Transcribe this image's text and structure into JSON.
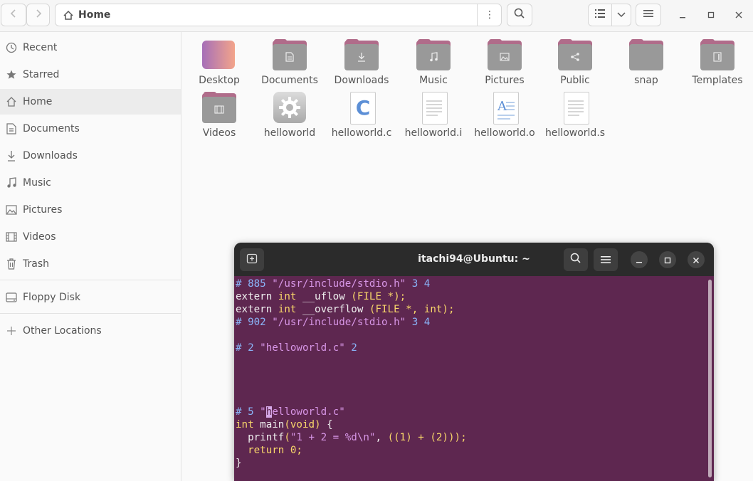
{
  "header": {
    "path_label": "Home",
    "icons": [
      "back-icon",
      "forward-icon",
      "home-icon",
      "more-options-icon",
      "search-icon",
      "list-view-icon",
      "chevron-down-icon",
      "hamburger-menu-icon",
      "minimize-icon",
      "maximize-icon",
      "close-icon"
    ]
  },
  "sidebar": {
    "items": [
      {
        "label": "Recent",
        "icon": "clock-icon"
      },
      {
        "label": "Starred",
        "icon": "star-icon"
      },
      {
        "label": "Home",
        "icon": "home-icon"
      },
      {
        "label": "Documents",
        "icon": "document-icon"
      },
      {
        "label": "Downloads",
        "icon": "download-icon"
      },
      {
        "label": "Music",
        "icon": "music-icon"
      },
      {
        "label": "Pictures",
        "icon": "picture-icon"
      },
      {
        "label": "Videos",
        "icon": "video-icon"
      },
      {
        "label": "Trash",
        "icon": "trash-icon"
      },
      {
        "label": "Floppy Disk",
        "icon": "drive-icon"
      },
      {
        "label": "Other Locations",
        "icon": "plus-icon"
      }
    ],
    "active": "Home"
  },
  "files": [
    {
      "name": "Desktop",
      "type": "desktop-folder"
    },
    {
      "name": "Documents",
      "type": "folder",
      "emblem": "document"
    },
    {
      "name": "Downloads",
      "type": "folder",
      "emblem": "download"
    },
    {
      "name": "Music",
      "type": "folder",
      "emblem": "music"
    },
    {
      "name": "Pictures",
      "type": "folder",
      "emblem": "picture"
    },
    {
      "name": "Public",
      "type": "folder",
      "emblem": "share"
    },
    {
      "name": "snap",
      "type": "folder",
      "emblem": ""
    },
    {
      "name": "Templates",
      "type": "folder",
      "emblem": "template"
    },
    {
      "name": "Videos",
      "type": "folder",
      "emblem": "video"
    },
    {
      "name": "helloworld",
      "type": "executable"
    },
    {
      "name": "helloworld.c",
      "type": "c-source"
    },
    {
      "name": "helloworld.i",
      "type": "text"
    },
    {
      "name": "helloworld.o",
      "type": "object"
    },
    {
      "name": "helloworld.s",
      "type": "text"
    }
  ],
  "terminal": {
    "title": "itachi94@Ubuntu: ~",
    "colors": {
      "background": "#5e2750",
      "directive": "#8ab4f8",
      "string": "#d796e6",
      "keyword": "#f9d76a",
      "text": "#f0f0f0"
    },
    "lines": [
      [
        [
          "# 885 ",
          "c-blue"
        ],
        [
          "\"/usr/include/stdio.h\"",
          "c-mag"
        ],
        [
          " 3 4",
          "c-blue"
        ]
      ],
      [
        [
          "extern ",
          "c-white"
        ],
        [
          "int",
          "c-yel"
        ],
        [
          " __uflow ",
          "c-white"
        ],
        [
          "(FILE *);",
          "c-yel"
        ]
      ],
      [
        [
          "extern ",
          "c-white"
        ],
        [
          "int",
          "c-yel"
        ],
        [
          " __overflow ",
          "c-white"
        ],
        [
          "(FILE *, int);",
          "c-yel"
        ]
      ],
      [
        [
          "# 902 ",
          "c-blue"
        ],
        [
          "\"/usr/include/stdio.h\"",
          "c-mag"
        ],
        [
          " 3 4",
          "c-blue"
        ]
      ],
      [],
      [
        [
          "# 2 ",
          "c-blue"
        ],
        [
          "\"helloworld.c\"",
          "c-mag"
        ],
        [
          " 2",
          "c-blue"
        ]
      ],
      [],
      [],
      [],
      [],
      [
        [
          "# 5 ",
          "c-blue"
        ],
        [
          "\"",
          "c-mag"
        ],
        [
          "h",
          "cursor"
        ],
        [
          "elloworld.c\"",
          "c-mag"
        ]
      ],
      [
        [
          "int",
          "c-yel"
        ],
        [
          " main",
          "c-white"
        ],
        [
          "(void)",
          "c-yel"
        ],
        [
          " {",
          "c-white"
        ]
      ],
      [
        [
          "  printf",
          "c-white"
        ],
        [
          "(",
          "c-yel"
        ],
        [
          "\"1 + 2 = %d\\n\"",
          "c-mag"
        ],
        [
          ", ",
          "c-white"
        ],
        [
          "((1) + (2)));",
          "c-yel"
        ]
      ],
      [
        [
          "  return ",
          "c-yel"
        ],
        [
          "0;",
          "c-yel"
        ]
      ],
      [
        [
          "}",
          "c-white"
        ]
      ]
    ]
  }
}
